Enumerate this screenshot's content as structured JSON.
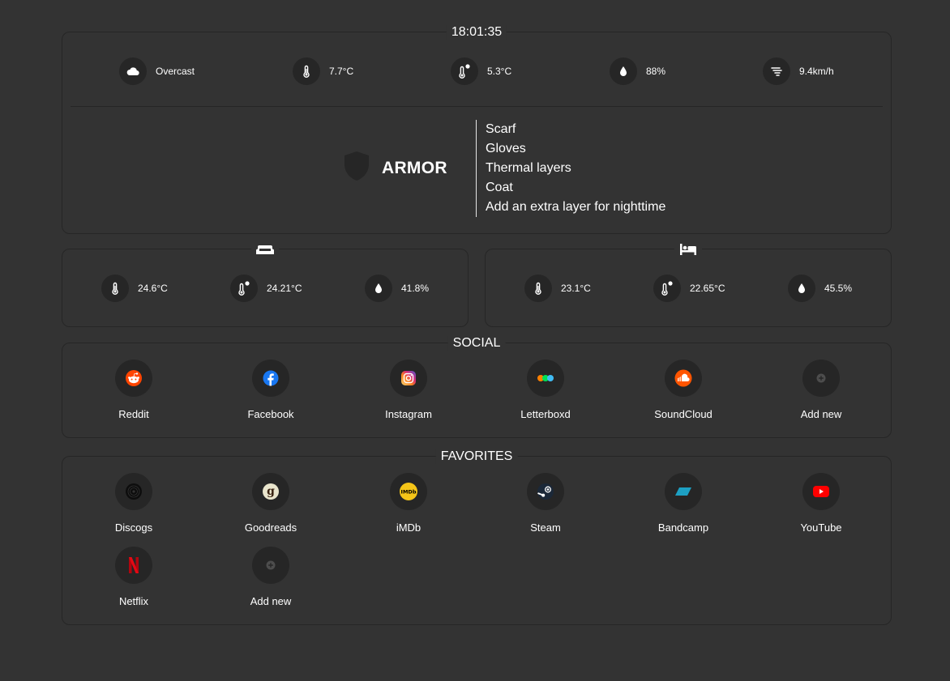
{
  "clock": "18:01:35",
  "weather": {
    "condition": "Overcast",
    "temperature": "7.7°C",
    "feels_like": "5.3°C",
    "humidity": "88%",
    "wind": "9.4km/h"
  },
  "armor": {
    "title": "ARMOR",
    "items": [
      "Scarf",
      "Gloves",
      "Thermal layers",
      "Coat",
      "Add an extra layer for nighttime"
    ]
  },
  "rooms": {
    "living_room": {
      "temperature": "24.6°C",
      "feels_like": "24.21°C",
      "humidity": "41.8%"
    },
    "bedroom": {
      "temperature": "23.1°C",
      "feels_like": "22.65°C",
      "humidity": "45.5%"
    }
  },
  "social": {
    "title": "SOCIAL",
    "links": [
      {
        "label": "Reddit",
        "icon": "reddit-icon",
        "color": "#ff4500"
      },
      {
        "label": "Facebook",
        "icon": "facebook-icon",
        "color": "#1877f2"
      },
      {
        "label": "Instagram",
        "icon": "instagram-icon",
        "color": "#e1306c"
      },
      {
        "label": "Letterboxd",
        "icon": "letterboxd-icon",
        "color": "#00e054"
      },
      {
        "label": "SoundCloud",
        "icon": "soundcloud-icon",
        "color": "#ff5500"
      },
      {
        "label": "Add new",
        "icon": "add-icon",
        "color": "#5a5a5a"
      }
    ]
  },
  "favorites": {
    "title": "FAVORITES",
    "links": [
      {
        "label": "Discogs",
        "icon": "discogs-icon",
        "color": "#111111"
      },
      {
        "label": "Goodreads",
        "icon": "goodreads-icon",
        "color": "#e9e5cd"
      },
      {
        "label": "iMDb",
        "icon": "imdb-icon",
        "color": "#f5c518"
      },
      {
        "label": "Steam",
        "icon": "steam-icon",
        "color": "#1b2838"
      },
      {
        "label": "Bandcamp",
        "icon": "bandcamp-icon",
        "color": "#1da0c3"
      },
      {
        "label": "YouTube",
        "icon": "youtube-icon",
        "color": "#ff0000"
      },
      {
        "label": "Netflix",
        "icon": "netflix-icon",
        "color": "#e50914"
      },
      {
        "label": "Add new",
        "icon": "add-icon",
        "color": "#5a5a5a"
      }
    ]
  },
  "imdb_badge": "IMDb"
}
